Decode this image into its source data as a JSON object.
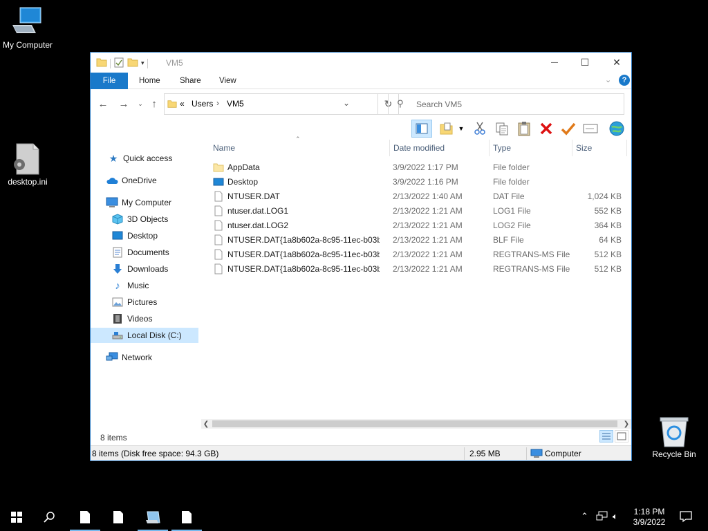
{
  "desktop": {
    "icons": [
      {
        "label": "My Computer",
        "icon": "computer-icon"
      },
      {
        "label": "desktop.ini",
        "icon": "settings-file-icon"
      },
      {
        "label": "Recycle Bin",
        "icon": "recycle-bin-icon"
      }
    ]
  },
  "window": {
    "title": "VM5",
    "controls": {
      "minimize": "—",
      "maximize": "☐",
      "close": "✕"
    },
    "ribbon_tabs": [
      "File",
      "Home",
      "Share",
      "View"
    ],
    "address": {
      "overflow": "«",
      "crumbs": [
        "Users",
        "VM5"
      ]
    },
    "search": {
      "placeholder": "Search VM5"
    },
    "columns": [
      "Name",
      "Date modified",
      "Type",
      "Size"
    ],
    "nav": {
      "quick_access": "Quick access",
      "onedrive": "OneDrive",
      "my_computer": "My Computer",
      "items": [
        "3D Objects",
        "Desktop",
        "Documents",
        "Downloads",
        "Music",
        "Pictures",
        "Videos",
        "Local Disk (C:)"
      ],
      "network": "Network"
    },
    "files": [
      {
        "name": "AppData",
        "date": "3/9/2022 1:17 PM",
        "type": "File folder",
        "size": "",
        "icon": "folder-icon"
      },
      {
        "name": "Desktop",
        "date": "3/9/2022 1:16 PM",
        "type": "File folder",
        "size": "",
        "icon": "desktop-folder-icon"
      },
      {
        "name": "NTUSER.DAT",
        "date": "2/13/2022 1:40 AM",
        "type": "DAT File",
        "size": "1,024 KB",
        "icon": "file-icon"
      },
      {
        "name": "ntuser.dat.LOG1",
        "date": "2/13/2022 1:21 AM",
        "type": "LOG1 File",
        "size": "552 KB",
        "icon": "file-icon"
      },
      {
        "name": "ntuser.dat.LOG2",
        "date": "2/13/2022 1:21 AM",
        "type": "LOG2 File",
        "size": "364 KB",
        "icon": "file-icon"
      },
      {
        "name": "NTUSER.DAT{1a8b602a-8c95-11ec-b03b-...",
        "date": "2/13/2022 1:21 AM",
        "type": "BLF File",
        "size": "64 KB",
        "icon": "file-icon"
      },
      {
        "name": "NTUSER.DAT{1a8b602a-8c95-11ec-b03b-...",
        "date": "2/13/2022 1:21 AM",
        "type": "REGTRANS-MS File",
        "size": "512 KB",
        "icon": "file-icon"
      },
      {
        "name": "NTUSER.DAT{1a8b602a-8c95-11ec-b03b-...",
        "date": "2/13/2022 1:21 AM",
        "type": "REGTRANS-MS File",
        "size": "512 KB",
        "icon": "file-icon"
      }
    ],
    "item_count": "8 items",
    "status": {
      "summary": "8 items (Disk free space: 94.3 GB)",
      "size": "2.95 MB",
      "location": "Computer"
    }
  },
  "taskbar": {
    "time": "1:18 PM",
    "date": "3/9/2022"
  },
  "colors": {
    "accent": "#1979ca",
    "selected": "#cce8ff",
    "desktop": "#000000"
  }
}
